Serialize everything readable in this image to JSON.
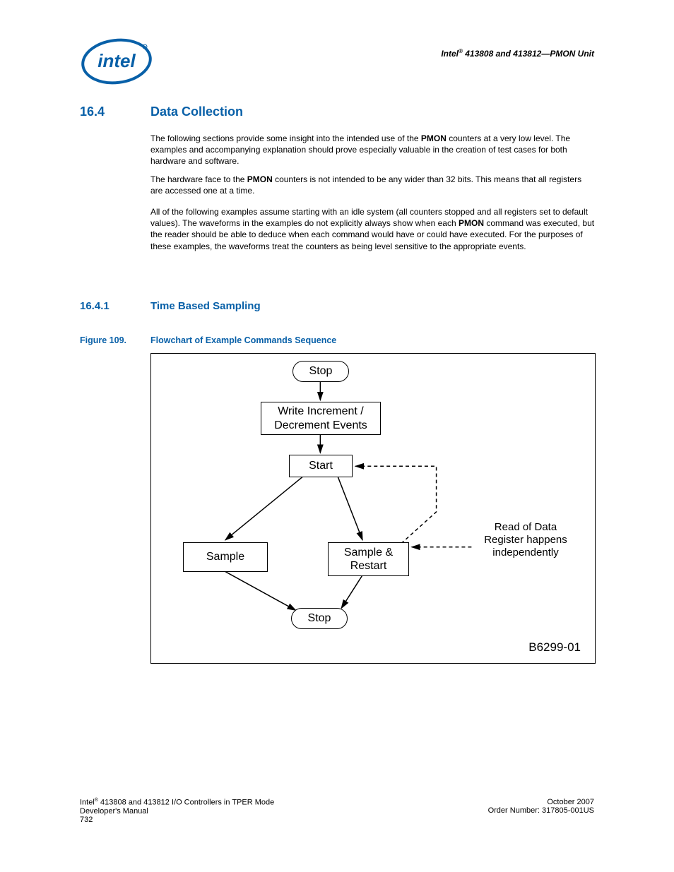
{
  "header": {
    "brand": "Intel",
    "reg": "®",
    "rest": " 413808 and 413812—PMON Unit"
  },
  "section": {
    "num": "16.4",
    "title": "Data Collection"
  },
  "para1": {
    "a": "The following sections provide some insight into the intended use of the ",
    "b": "PMON",
    "c": " counters at a very low level. The examples and accompanying explanation should prove especially valuable in the creation of test cases for both hardware and software."
  },
  "para2": {
    "a": "The hardware face to the ",
    "b": "PMON",
    "c": " counters is not intended to be any wider than 32 bits. This means that all registers are accessed one at a time."
  },
  "para3": {
    "a": "All of the following examples assume starting with an idle system (all counters stopped and all registers set to default values). The waveforms in the examples do not explicitly always show when each ",
    "b": "PMON",
    "c": " command was executed, but the reader should be able to deduce when each command would have or could have executed. For the purposes of these examples, the waveforms treat the counters as being level sensitive to the appropriate events."
  },
  "subsection": {
    "num": "16.4.1",
    "title": "Time Based Sampling"
  },
  "figure": {
    "num": "Figure 109.",
    "caption": "Flowchart of Example Commands Sequence",
    "id": "B6299-01",
    "nodes": {
      "stop1": "Stop",
      "write": "Write Increment /\nDecrement Events",
      "start": "Start",
      "sample": "Sample",
      "sample_restart": "Sample &\nRestart",
      "stop2": "Stop",
      "note": "Read of Data\nRegister happens\nindependently"
    }
  },
  "footer": {
    "left1a": "Intel",
    "left1b": "®",
    "left1c": " 413808 and 413812 I/O Controllers in TPER Mode",
    "left2": "Developer's Manual",
    "left3": "732",
    "right1": "October 2007",
    "right2": "Order Number: 317805-001US"
  }
}
